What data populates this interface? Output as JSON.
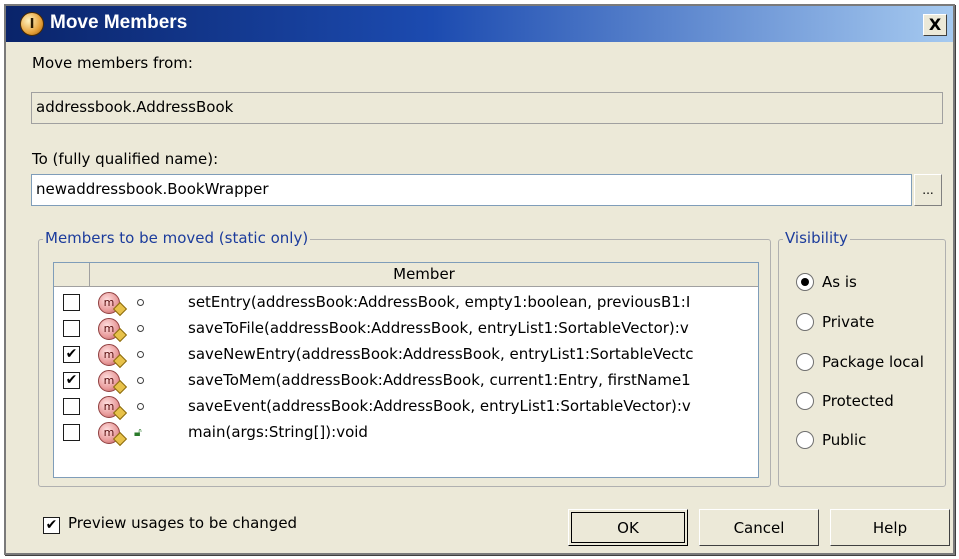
{
  "window": {
    "title": "Move Members",
    "close_label": "X",
    "app_icon_glyph": "I"
  },
  "from": {
    "label": "Move members from:",
    "value": "addressbook.AddressBook"
  },
  "to": {
    "label": "To (fully qualified name):",
    "value": "newaddressbook.BookWrapper",
    "browse_label": "..."
  },
  "members": {
    "group_title": "Members to be moved (static only)",
    "column_header": "Member",
    "rows": [
      {
        "checked": false,
        "check_mark": "",
        "visibility_icon": "package-dot-icon",
        "signature": "setEntry(addressBook:AddressBook, empty1:boolean, previousB1:I"
      },
      {
        "checked": false,
        "check_mark": "",
        "visibility_icon": "package-dot-icon",
        "signature": "saveToFile(addressBook:AddressBook, entryList1:SortableVector):v"
      },
      {
        "checked": true,
        "check_mark": "✔",
        "visibility_icon": "package-dot-icon",
        "signature": "saveNewEntry(addressBook:AddressBook, entryList1:SortableVectc"
      },
      {
        "checked": true,
        "check_mark": "✔",
        "visibility_icon": "package-dot-icon",
        "signature": "saveToMem(addressBook:AddressBook, current1:Entry, firstName1"
      },
      {
        "checked": false,
        "check_mark": "",
        "visibility_icon": "package-dot-icon",
        "signature": "saveEvent(addressBook:AddressBook, entryList1:SortableVector):v"
      },
      {
        "checked": false,
        "check_mark": "",
        "visibility_icon": "public-lock-icon",
        "signature": "main(args:String[]):void"
      }
    ],
    "method_icon_glyph": "m"
  },
  "visibility": {
    "group_title": "Visibility",
    "options": [
      {
        "label": "As is",
        "selected": true
      },
      {
        "label": "Private",
        "selected": false
      },
      {
        "label": "Package local",
        "selected": false
      },
      {
        "label": "Protected",
        "selected": false
      },
      {
        "label": "Public",
        "selected": false
      }
    ]
  },
  "preview": {
    "label": "Preview usages to be changed",
    "checked": true,
    "check_mark": "✔"
  },
  "buttons": {
    "ok": "OK",
    "cancel": "Cancel",
    "help": "Help"
  },
  "colors": {
    "title_gradient_start": "#0a246a",
    "title_gradient_end": "#a6caf0",
    "dialog_bg": "#ece9d8",
    "group_title": "#1c3c9c"
  }
}
